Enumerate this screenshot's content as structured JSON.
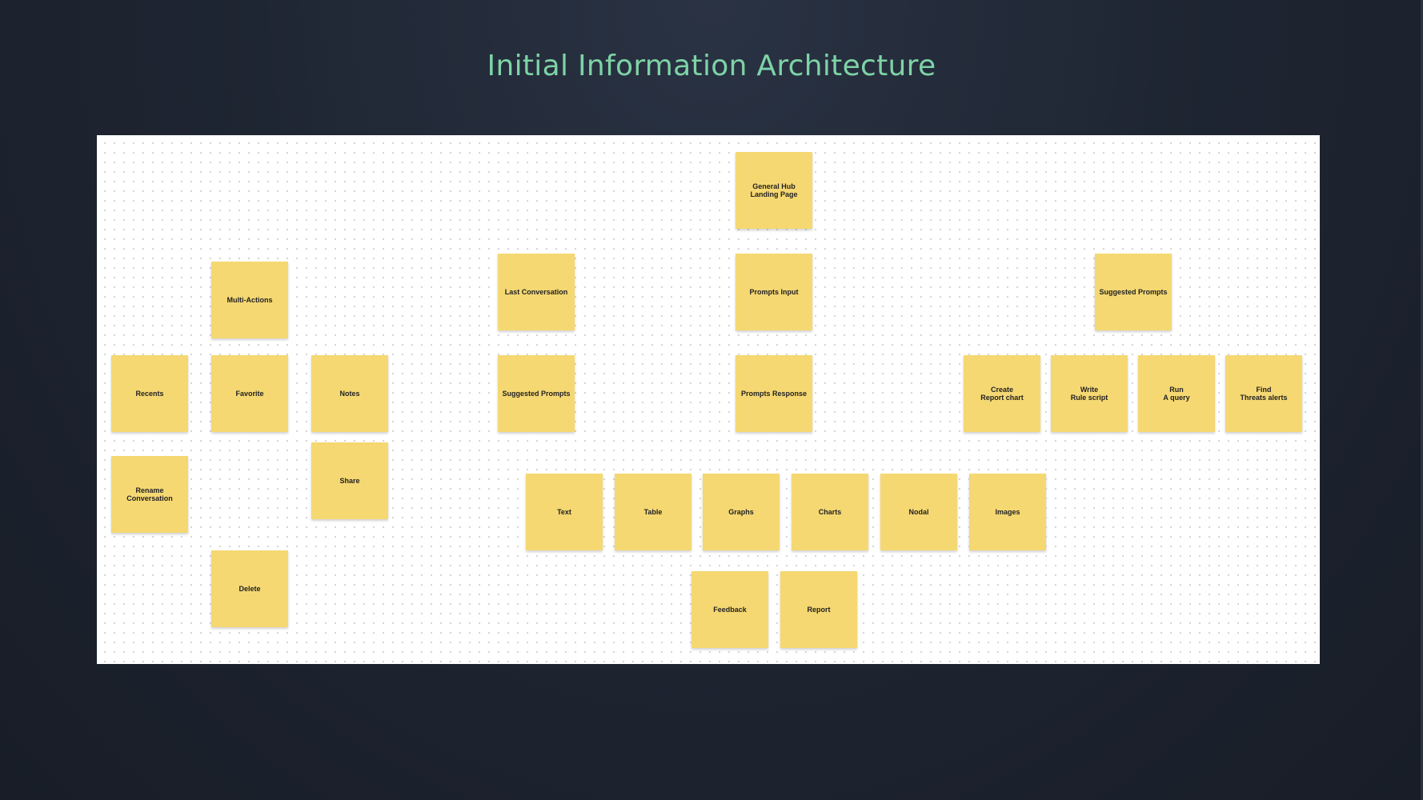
{
  "slide": {
    "title": "Initial Information Architecture"
  },
  "colors": {
    "background": "#1f2633",
    "title": "#7ed3a6",
    "board": "#ffffff",
    "sticky_note": "#f5d872",
    "note_text": "#222222"
  },
  "notes": {
    "general_hub": "General Hub\nLanding Page",
    "multi_actions": "Multi-Actions",
    "last_conversation": "Last Conversation",
    "prompts_input": "Prompts  Input",
    "suggested_prompts_top": "Suggested Prompts",
    "recents": "Recents",
    "favorite": "Favorite",
    "notes": "Notes",
    "suggested_prompts_left": "Suggested Prompts",
    "prompts_response": "Prompts Response",
    "create_report_chart": "Create\nReport chart",
    "write_rule_script": "Write\nRule script",
    "run_a_query": "Run\nA query",
    "find_threats_alerts": "Find\nThreats alerts",
    "rename_conversation": "Rename\nConversation",
    "share": "Share",
    "text": "Text",
    "table": "Table",
    "graphs": "Graphs",
    "charts": "Charts",
    "nodal": "Nodal",
    "images": "Images",
    "delete": "Delete",
    "feedback": "Feedback",
    "report": "Report"
  }
}
